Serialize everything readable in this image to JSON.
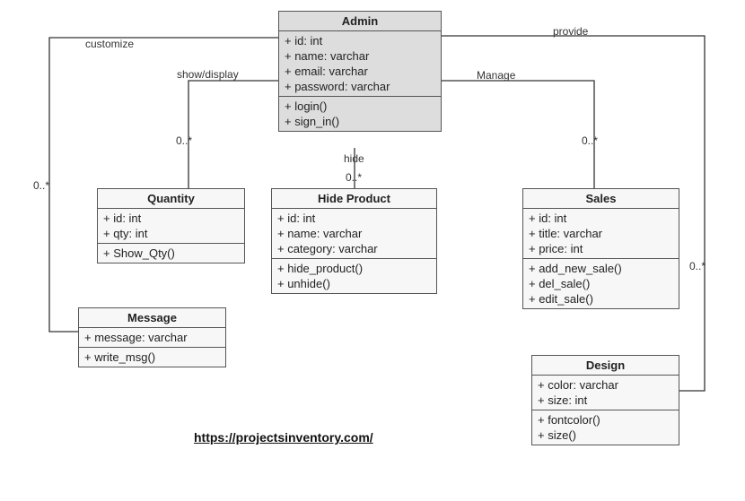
{
  "diagram": {
    "admin": {
      "title": "Admin",
      "attrs": [
        "+ id: int",
        "+ name: varchar",
        "+ email: varchar",
        "+ password: varchar"
      ],
      "ops": [
        "+ login()",
        "+ sign_in()"
      ]
    },
    "quantity": {
      "title": "Quantity",
      "attrs": [
        "+ id: int",
        "+ qty: int"
      ],
      "ops": [
        "+ Show_Qty()"
      ]
    },
    "hide_product": {
      "title": "Hide Product",
      "attrs": [
        "+ id: int",
        "+ name: varchar",
        "+ category: varchar"
      ],
      "ops": [
        "+ hide_product()",
        "+ unhide()"
      ]
    },
    "sales": {
      "title": "Sales",
      "attrs": [
        "+ id: int",
        "+ title: varchar",
        "+ price: int"
      ],
      "ops": [
        "+ add_new_sale()",
        "+ del_sale()",
        "+ edit_sale()"
      ]
    },
    "message": {
      "title": "Message",
      "attrs": [
        "+ message: varchar"
      ],
      "ops": [
        "+ write_msg()"
      ]
    },
    "design": {
      "title": "Design",
      "attrs": [
        "+ color: varchar",
        "+ size: int"
      ],
      "ops": [
        "+ fontcolor()",
        "+ size()"
      ]
    }
  },
  "edges": {
    "customize": {
      "label": "customize",
      "mult": "0..*"
    },
    "show_display": {
      "label": "show/display",
      "mult": "0..*"
    },
    "hide": {
      "label": "hide",
      "mult": "0..*"
    },
    "manage": {
      "label": "Manage",
      "mult": "0..*"
    },
    "provide": {
      "label": "provide",
      "mult": "0..*"
    }
  },
  "footer": {
    "url": "https://projectsinventory.com/"
  }
}
